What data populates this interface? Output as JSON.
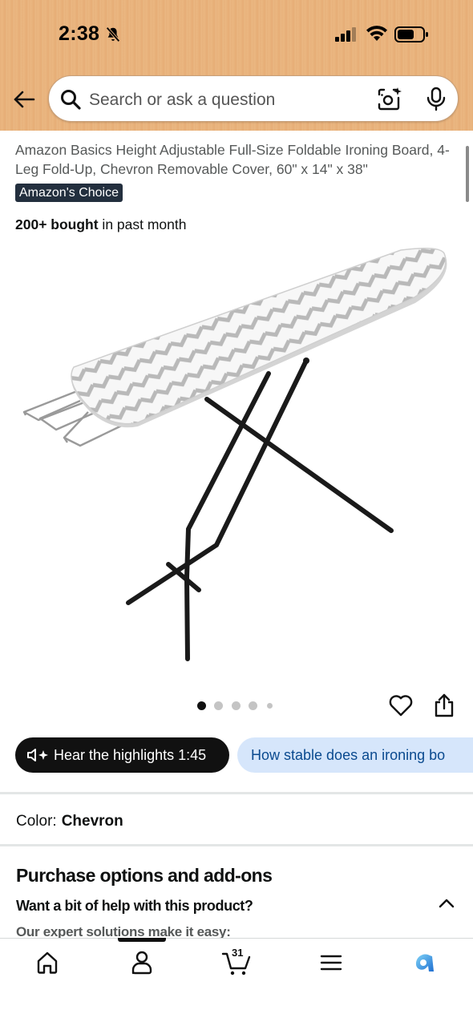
{
  "status_bar": {
    "time": "2:38",
    "icons": [
      "bell-off-icon",
      "cellular-signal-icon",
      "wifi-icon",
      "battery-icon"
    ]
  },
  "search": {
    "placeholder": "Search or ask a question",
    "icons": [
      "back-arrow-icon",
      "search-icon",
      "camera-lens-icon",
      "microphone-icon"
    ]
  },
  "product": {
    "title": "Amazon Basics Height Adjustable Full-Size Foldable Ironing Board, 4-Leg Fold-Up, Chevron Removable Cover, 60\" x 14\" x 38\"",
    "badge": "Amazon's Choice",
    "bought_bold": "200+ bought",
    "bought_rest": " in past month",
    "image_icon": "ironing-board-image",
    "image_count": 5,
    "active_image": 1
  },
  "actions": {
    "icons": [
      "heart-icon",
      "share-icon"
    ]
  },
  "pills": {
    "hear": "Hear the highlights 1:45",
    "question": "How stable does an ironing bo"
  },
  "color": {
    "label": "Color:",
    "value": "Chevron"
  },
  "purchase": {
    "title": "Purchase options and add-ons",
    "help": "Want a bit of help with this product?",
    "expert": "Our expert solutions make it easy:"
  },
  "bottom_nav": {
    "items": [
      "home-icon",
      "account-icon",
      "cart-icon",
      "menu-icon",
      "rufus-icon"
    ],
    "cart_count": "31",
    "active_index": 1
  },
  "colors": {
    "header_bg": "#e8b27c",
    "badge_bg": "#232f3e",
    "question_pill_bg": "#d6e6fb",
    "question_pill_text": "#0a4a8f",
    "rufus_accent": "#2b8fd6"
  }
}
